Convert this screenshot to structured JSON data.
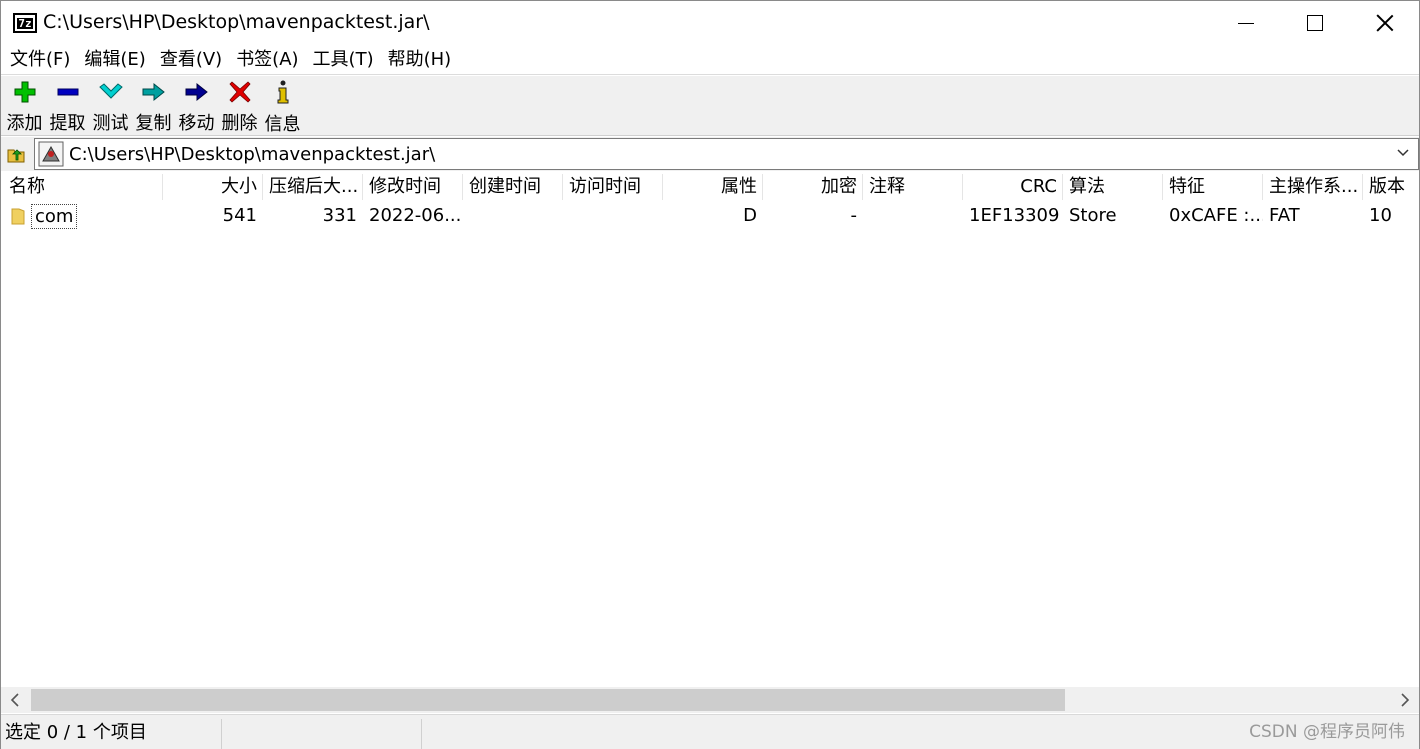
{
  "window": {
    "title": "C:\\Users\\HP\\Desktop\\mavenpacktest.jar\\",
    "icon_text": "7z"
  },
  "menu": [
    "文件(F)",
    "编辑(E)",
    "查看(V)",
    "书签(A)",
    "工具(T)",
    "帮助(H)"
  ],
  "toolbar": [
    {
      "label": "添加",
      "icon": "add-icon",
      "color": "#00c000"
    },
    {
      "label": "提取",
      "icon": "extract-icon",
      "color": "#0000c0"
    },
    {
      "label": "测试",
      "icon": "test-icon",
      "color": "#00c8c8"
    },
    {
      "label": "复制",
      "icon": "copy-icon",
      "color": "#008080"
    },
    {
      "label": "移动",
      "icon": "move-icon",
      "color": "#000080"
    },
    {
      "label": "删除",
      "icon": "delete-icon",
      "color": "#e00000"
    },
    {
      "label": "信息",
      "icon": "info-icon",
      "color": "#c0a000"
    }
  ],
  "address": {
    "path": "C:\\Users\\HP\\Desktop\\mavenpacktest.jar\\"
  },
  "columns": [
    "名称",
    "大小",
    "压缩后大...",
    "修改时间",
    "创建时间",
    "访问时间",
    "属性",
    "加密",
    "注释",
    "CRC",
    "算法",
    "特征",
    "主操作系...",
    "版本"
  ],
  "rows": [
    {
      "name": "com",
      "size": "541",
      "packed": "331",
      "modified": "2022-06...",
      "created": "",
      "accessed": "",
      "attributes": "D",
      "encrypted": "-",
      "comment": "",
      "crc": "1EF13309",
      "method": "Store",
      "characteristics": "0xCAFE :...",
      "host_os": "FAT",
      "version": "10"
    }
  ],
  "status": {
    "selection": "选定 0 / 1 个项目",
    "watermark": "CSDN @程序员阿伟"
  }
}
